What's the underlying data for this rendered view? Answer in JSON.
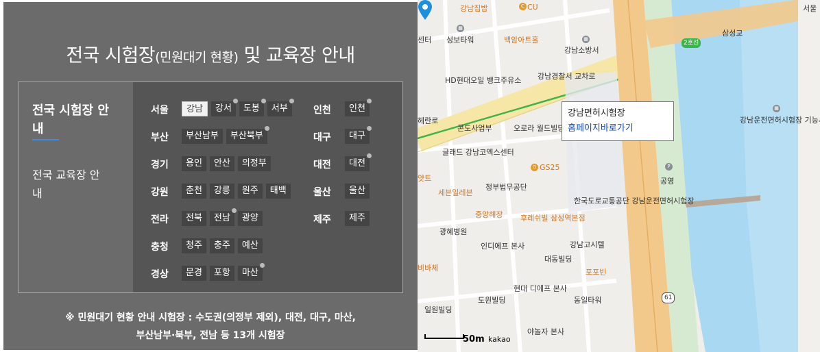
{
  "left": {
    "title_main": "전국 시험장",
    "title_small": "(민원대기 현황)",
    "title_tail": " 및 교육장 안내",
    "side_tab_1": "전국 시험장 안내",
    "side_tab_2": "전국 교육장 안내",
    "regions_left": [
      {
        "name": "서울",
        "chips": [
          {
            "label": "강남",
            "active": true,
            "dot": false
          },
          {
            "label": "강서",
            "dot": true
          },
          {
            "label": "도봉",
            "dot": true
          },
          {
            "label": "서부",
            "dot": true
          }
        ]
      },
      {
        "name": "부산",
        "chips": [
          {
            "label": "부산남부",
            "dot": false
          },
          {
            "label": "부산북부",
            "dot": true
          }
        ]
      },
      {
        "name": "경기",
        "chips": [
          {
            "label": "용인",
            "dot": false
          },
          {
            "label": "안산",
            "dot": false
          },
          {
            "label": "의정부",
            "dot": false
          }
        ]
      },
      {
        "name": "강원",
        "chips": [
          {
            "label": "춘천",
            "dot": false
          },
          {
            "label": "강릉",
            "dot": false
          },
          {
            "label": "원주",
            "dot": false
          },
          {
            "label": "태백",
            "dot": false
          }
        ]
      },
      {
        "name": "전라",
        "chips": [
          {
            "label": "전북",
            "dot": false
          },
          {
            "label": "전남",
            "dot": true
          },
          {
            "label": "광양",
            "dot": false
          }
        ]
      },
      {
        "name": "충청",
        "chips": [
          {
            "label": "청주",
            "dot": false
          },
          {
            "label": "충주",
            "dot": false
          },
          {
            "label": "예산",
            "dot": false
          }
        ]
      },
      {
        "name": "경상",
        "chips": [
          {
            "label": "문경",
            "dot": false
          },
          {
            "label": "포항",
            "dot": false
          },
          {
            "label": "마산",
            "dot": true
          }
        ]
      }
    ],
    "regions_right": [
      {
        "name": "인천",
        "chips": [
          {
            "label": "인천",
            "dot": true
          }
        ]
      },
      {
        "name": "대구",
        "chips": [
          {
            "label": "대구",
            "dot": true
          }
        ]
      },
      {
        "name": "대전",
        "chips": [
          {
            "label": "대전",
            "dot": true
          }
        ]
      },
      {
        "name": "울산",
        "chips": [
          {
            "label": "울산",
            "dot": false
          }
        ]
      },
      {
        "name": "제주",
        "chips": [
          {
            "label": "제주",
            "dot": false
          }
        ]
      }
    ],
    "note_line1": "※ 민원대기 현황 안내 시험장 : 수도권(의정부 제외), 대전, 대구, 마산,",
    "note_line2": "부산남부·북부, 전남 등 13개 시험장"
  },
  "map": {
    "popup_title": "강남면허시험장",
    "popup_link": "홈페이지바로가기",
    "scale": "50m",
    "brand": "kakao",
    "labels": [
      {
        "t": "강남집밥"
      },
      {
        "t": "CU"
      },
      {
        "t": "성보타워"
      },
      {
        "t": "센터"
      },
      {
        "t": "백암아트홀"
      },
      {
        "t": "강남소방서"
      },
      {
        "t": "HD현대오일 뱅크주유소"
      },
      {
        "t": "강남경찰서 교차로"
      },
      {
        "t": "콘도사업부"
      },
      {
        "t": "오로라 월드빌딩"
      },
      {
        "t": "글래드 강남코엑스센터"
      },
      {
        "t": "GS25"
      },
      {
        "t": "정부법무공단"
      },
      {
        "t": "세븐일레븐"
      },
      {
        "t": "중앙해장"
      },
      {
        "t": "후레쉬빌 삼성역본점"
      },
      {
        "t": "한국도로교통공단 강남운전면허시험장"
      },
      {
        "t": "광혜병원"
      },
      {
        "t": "인디에프 본사"
      },
      {
        "t": "강남고시텔"
      },
      {
        "t": "대동빌딩"
      },
      {
        "t": "포포빈"
      },
      {
        "t": "도원빌딩"
      },
      {
        "t": "현대 디에프 본사"
      },
      {
        "t": "동일타워"
      },
      {
        "t": "일원빌딩"
      },
      {
        "t": "야놀자 본사"
      },
      {
        "t": "공영"
      },
      {
        "t": "강남운전면허시험장 기능시험장"
      },
      {
        "t": "삼성교"
      },
      {
        "t": "2호선"
      },
      {
        "t": "서울"
      },
      {
        "t": "61"
      },
      {
        "t": "헤란로"
      },
      {
        "t": "비바체"
      },
      {
        "t": "얏트"
      }
    ]
  },
  "colors": {
    "panel": "#6b6b6b",
    "box": "#555555",
    "chip": "#444444",
    "accent": "#3a8ee6",
    "link": "#0b47c7",
    "river": "#a9d8f3",
    "road_major": "#f3c98b",
    "line2": "#3bb44a"
  }
}
